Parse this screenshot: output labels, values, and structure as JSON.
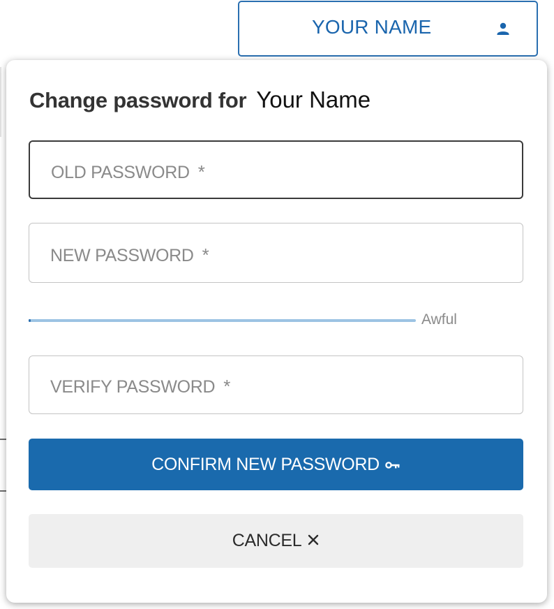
{
  "header": {
    "user_button_label": "YOUR NAME",
    "user_icon": "person-icon"
  },
  "dialog": {
    "title_prefix": "Change password for",
    "title_name": "Your Name",
    "fields": {
      "old_password": {
        "placeholder": "OLD PASSWORD",
        "required_mark": "*",
        "value": ""
      },
      "new_password": {
        "placeholder": "NEW PASSWORD",
        "required_mark": "*",
        "value": ""
      },
      "verify_password": {
        "placeholder": "VERIFY PASSWORD",
        "required_mark": "*",
        "value": ""
      }
    },
    "strength": {
      "label": "Awful",
      "level": 0
    },
    "confirm_button": {
      "label": "CONFIRM NEW PASSWORD",
      "icon": "key-icon"
    },
    "cancel_button": {
      "label": "CANCEL",
      "icon": "close-icon"
    }
  },
  "colors": {
    "accent": "#1a6aad",
    "strength_track": "#9cc3e3",
    "secondary_bg": "#efefef"
  }
}
